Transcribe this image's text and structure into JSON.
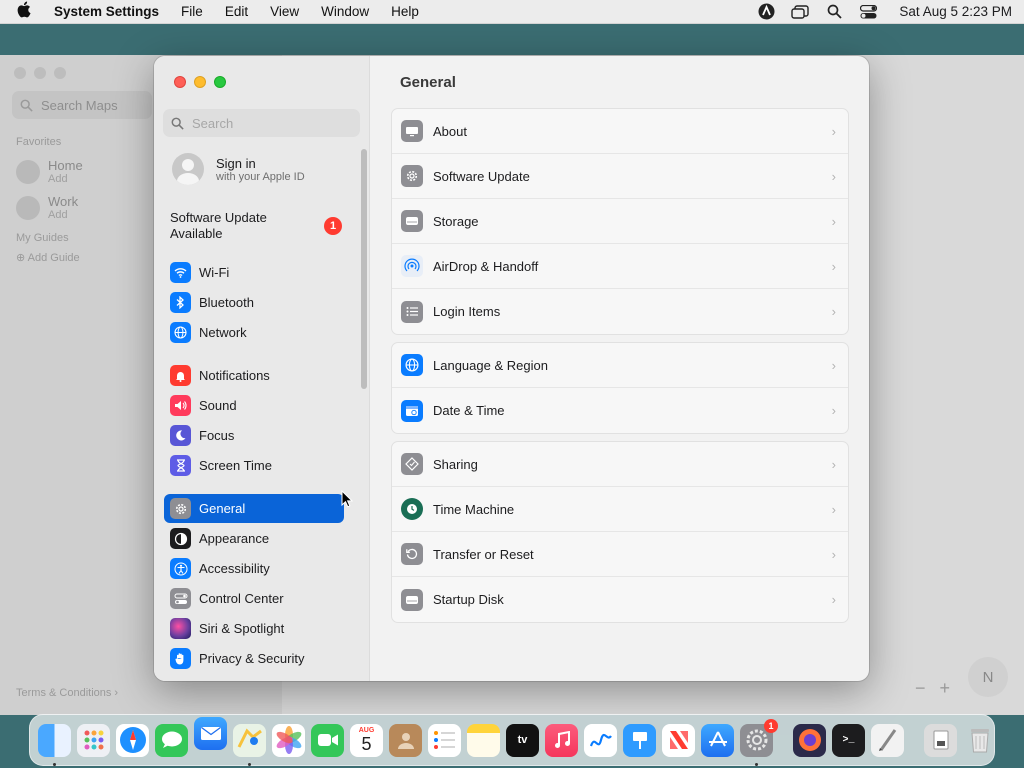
{
  "menubar": {
    "app_name": "System Settings",
    "menus": [
      "File",
      "Edit",
      "View",
      "Window",
      "Help"
    ],
    "clock": "Sat Aug 5  2:23 PM"
  },
  "maps": {
    "search_placeholder": "Search Maps",
    "favorites_label": "Favorites",
    "places": [
      {
        "name": "Home",
        "sub": "Add"
      },
      {
        "name": "Work",
        "sub": "Add"
      }
    ],
    "guides_label": "My Guides",
    "add_guide": "Add Guide",
    "terms": "Terms & Conditions ›",
    "compass": "N"
  },
  "sidebar": {
    "search_placeholder": "Search",
    "signin_title": "Sign in",
    "signin_sub": "with your Apple ID",
    "update_line1": "Software Update",
    "update_line2": "Available",
    "update_badge": "1",
    "items": [
      {
        "label": "Wi-Fi",
        "icon": "wifi-icon",
        "color": "#0a7cff"
      },
      {
        "label": "Bluetooth",
        "icon": "bluetooth-icon",
        "color": "#0a7cff"
      },
      {
        "label": "Network",
        "icon": "globe-icon",
        "color": "#0a7cff"
      },
      {
        "label": "Notifications",
        "icon": "bell-icon",
        "color": "#ff3b30"
      },
      {
        "label": "Sound",
        "icon": "speaker-icon",
        "color": "#ff3b5c"
      },
      {
        "label": "Focus",
        "icon": "moon-icon",
        "color": "#5856d6"
      },
      {
        "label": "Screen Time",
        "icon": "hourglass-icon",
        "color": "#5e5ce6"
      },
      {
        "label": "General",
        "icon": "gear-icon",
        "color": "#8e8e93"
      },
      {
        "label": "Appearance",
        "icon": "appearance-icon",
        "color": "#1c1c1e"
      },
      {
        "label": "Accessibility",
        "icon": "accessibility-icon",
        "color": "#0a7cff"
      },
      {
        "label": "Control Center",
        "icon": "control-center-icon",
        "color": "#8e8e93"
      },
      {
        "label": "Siri & Spotlight",
        "icon": "siri-icon",
        "color": "#6b3fa0"
      },
      {
        "label": "Privacy & Security",
        "icon": "hand-icon",
        "color": "#0a7cff"
      }
    ]
  },
  "content": {
    "title": "General",
    "groups": [
      [
        {
          "label": "About",
          "icon": "computer-icon",
          "color": "#8e8e93"
        },
        {
          "label": "Software Update",
          "icon": "gear-badge-icon",
          "color": "#8e8e93"
        },
        {
          "label": "Storage",
          "icon": "drive-icon",
          "color": "#8e8e93"
        },
        {
          "label": "AirDrop & Handoff",
          "icon": "airdrop-icon",
          "color": "#e8eef7"
        },
        {
          "label": "Login Items",
          "icon": "list-icon",
          "color": "#8e8e93"
        }
      ],
      [
        {
          "label": "Language & Region",
          "icon": "globe-icon",
          "color": "#0a7cff"
        },
        {
          "label": "Date & Time",
          "icon": "calendar-clock-icon",
          "color": "#0a7cff"
        }
      ],
      [
        {
          "label": "Sharing",
          "icon": "sharing-icon",
          "color": "#8e8e93"
        },
        {
          "label": "Time Machine",
          "icon": "time-machine-icon",
          "color": "#1a6e55"
        },
        {
          "label": "Transfer or Reset",
          "icon": "reset-icon",
          "color": "#8e8e93"
        },
        {
          "label": "Startup Disk",
          "icon": "disk-icon",
          "color": "#8e8e93"
        }
      ]
    ]
  },
  "dock": {
    "calendar_month": "AUG",
    "calendar_day": "5",
    "tv_label": "tv",
    "settings_badge": "1"
  }
}
